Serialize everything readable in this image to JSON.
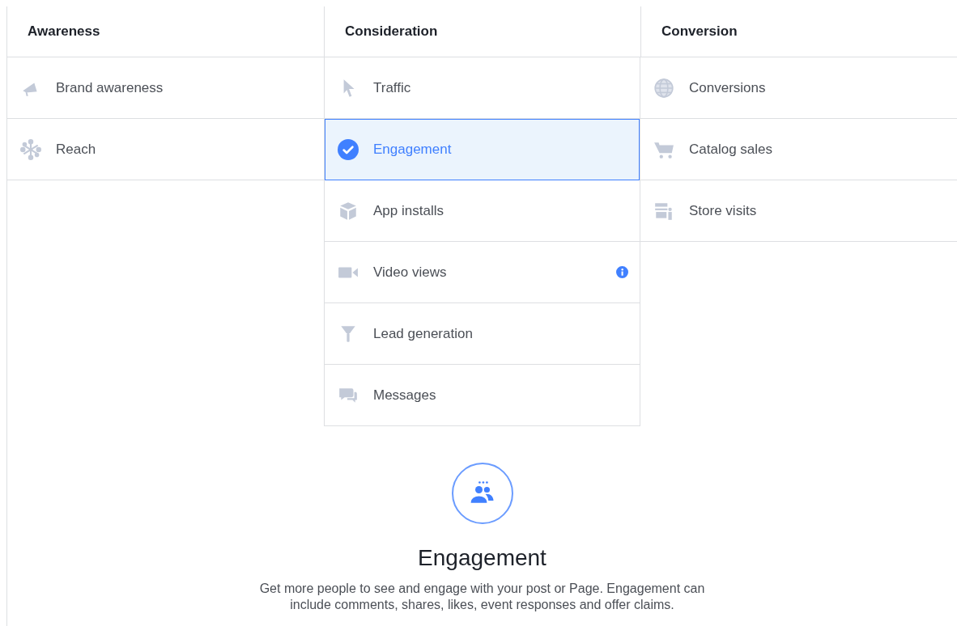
{
  "columns": [
    {
      "title": "Awareness",
      "items": [
        {
          "label": "Brand awareness",
          "kind": "megaphone",
          "selected": false,
          "info": false
        },
        {
          "label": "Reach",
          "kind": "reach",
          "selected": false,
          "info": false
        }
      ]
    },
    {
      "title": "Consideration",
      "items": [
        {
          "label": "Traffic",
          "kind": "cursor",
          "selected": false,
          "info": false
        },
        {
          "label": "Engagement",
          "selected": true,
          "info": false
        },
        {
          "label": "App installs",
          "kind": "cube",
          "selected": false,
          "info": false
        },
        {
          "label": "Video views",
          "kind": "video",
          "selected": false,
          "info": true
        },
        {
          "label": "Lead generation",
          "kind": "funnel",
          "selected": false,
          "info": false
        },
        {
          "label": "Messages",
          "kind": "chat",
          "selected": false,
          "info": false
        }
      ]
    },
    {
      "title": "Conversion",
      "items": [
        {
          "label": "Conversions",
          "kind": "globe",
          "selected": false,
          "info": false
        },
        {
          "label": "Catalog sales",
          "kind": "cart",
          "selected": false,
          "info": false
        },
        {
          "label": "Store visits",
          "kind": "store",
          "selected": false,
          "info": false
        }
      ]
    }
  ],
  "detail": {
    "title": "Engagement",
    "description": "Get more people to see and engage with your post or Page. Engagement can include comments, shares, likes, event responses and offer claims."
  }
}
